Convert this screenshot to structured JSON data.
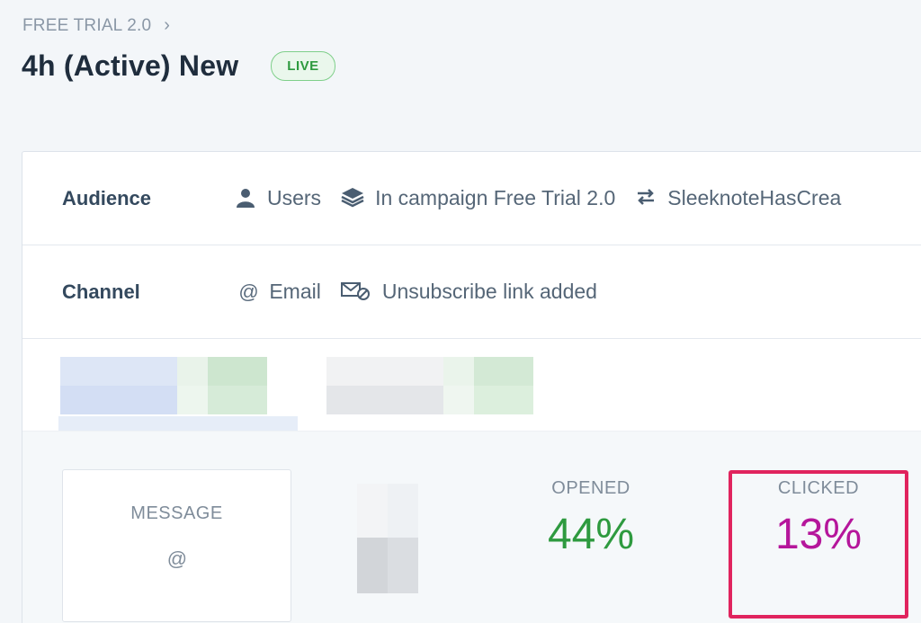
{
  "breadcrumb": {
    "label": "FREE TRIAL 2.0"
  },
  "header": {
    "title": "4h (Active) New",
    "status_badge": "LIVE"
  },
  "audience": {
    "label": "Audience",
    "items": [
      {
        "icon": "user-icon",
        "text": "Users"
      },
      {
        "icon": "layers-icon",
        "text": "In campaign Free Trial 2.0"
      },
      {
        "icon": "swap-arrows-icon",
        "text": "SleeknoteHasCrea"
      }
    ]
  },
  "channel": {
    "label": "Channel",
    "items": [
      {
        "icon": "at-icon",
        "text": "Email"
      },
      {
        "icon": "unsubscribe-icon",
        "text": "Unsubscribe link added"
      }
    ]
  },
  "stats": {
    "message": {
      "label": "MESSAGE",
      "icon": "@"
    },
    "opened": {
      "label": "OPENED",
      "value": "44%",
      "color": "#2e9a3f"
    },
    "clicked": {
      "label": "CLICKED",
      "value": "13%",
      "color": "#b5169b"
    },
    "highlight_color": "#e0245e"
  }
}
